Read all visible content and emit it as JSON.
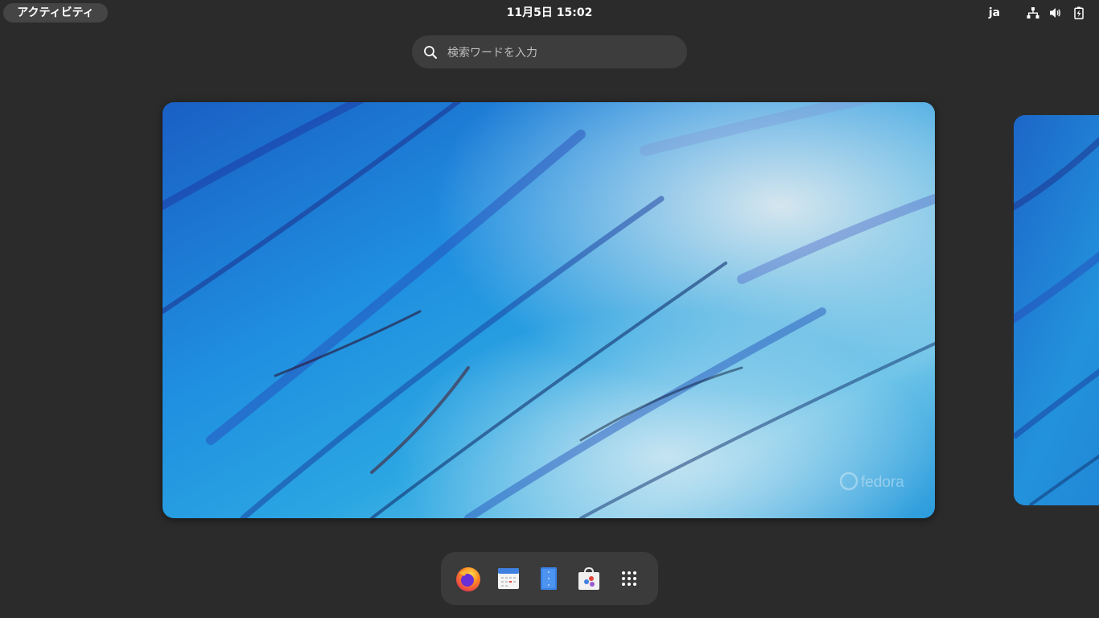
{
  "topbar": {
    "activities_label": "アクティビティ",
    "clock": "11月5日  15:02",
    "input_language": "ja",
    "tray_icons": [
      "network-wired-icon",
      "volume-icon",
      "battery-charging-icon"
    ]
  },
  "search": {
    "placeholder": "検索ワードを入力",
    "value": "",
    "icon": "search-icon"
  },
  "workspaces": {
    "current_watermark": "fedora",
    "count_visible": 2
  },
  "dash": {
    "items": [
      {
        "name": "firefox",
        "icon": "firefox-icon"
      },
      {
        "name": "calendar",
        "icon": "calendar-icon"
      },
      {
        "name": "text-editor",
        "icon": "text-editor-icon"
      },
      {
        "name": "software",
        "icon": "software-icon"
      },
      {
        "name": "show-apps",
        "icon": "app-grid-icon"
      }
    ]
  },
  "colors": {
    "background": "#2b2b2b",
    "panel_pill": "#454545",
    "search_bg": "#3d3d3d",
    "dash_bg": "#3b3b3b",
    "wallpaper_blue": "#1e7fd0"
  }
}
